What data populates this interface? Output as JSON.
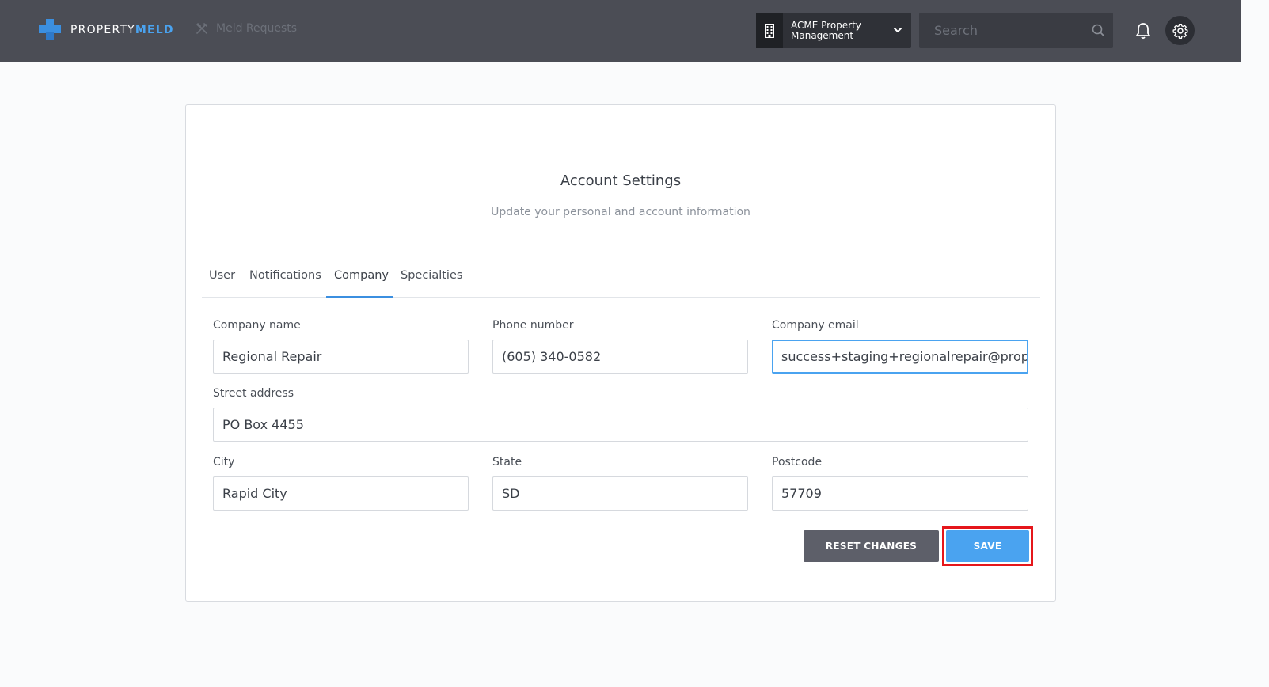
{
  "header": {
    "brand_prefix": "PROPERTY",
    "brand_suffix": "MELD",
    "nav_link": "Meld Requests",
    "org_name": "ACME Property Management",
    "search_placeholder": "Search",
    "colors": {
      "bar": "#4b4d55",
      "accent": "#3b8fe0"
    },
    "icons": [
      "building-icon",
      "chevron-down-icon",
      "search-icon",
      "bell-icon",
      "gear-icon",
      "tools-icon"
    ]
  },
  "card": {
    "title": "Account Settings",
    "subtitle": "Update your personal and account information"
  },
  "tabs": [
    {
      "label": "User",
      "active": false
    },
    {
      "label": "Notifications",
      "active": false
    },
    {
      "label": "Company",
      "active": true
    },
    {
      "label": "Specialties",
      "active": false
    }
  ],
  "form": {
    "company_name": {
      "label": "Company name",
      "value": "Regional Repair"
    },
    "phone": {
      "label": "Phone number",
      "value": "(605) 340-0582"
    },
    "email": {
      "label": "Company email",
      "value": "success+staging+regionalrepair@propertymeld.com"
    },
    "street": {
      "label": "Street address",
      "value": "PO Box 4455"
    },
    "city": {
      "label": "City",
      "value": "Rapid City"
    },
    "state": {
      "label": "State",
      "value": "SD"
    },
    "postcode": {
      "label": "Postcode",
      "value": "57709"
    }
  },
  "actions": {
    "reset_label": "RESET CHANGES",
    "save_label": "SAVE",
    "highlight_color": "#e5161b"
  }
}
